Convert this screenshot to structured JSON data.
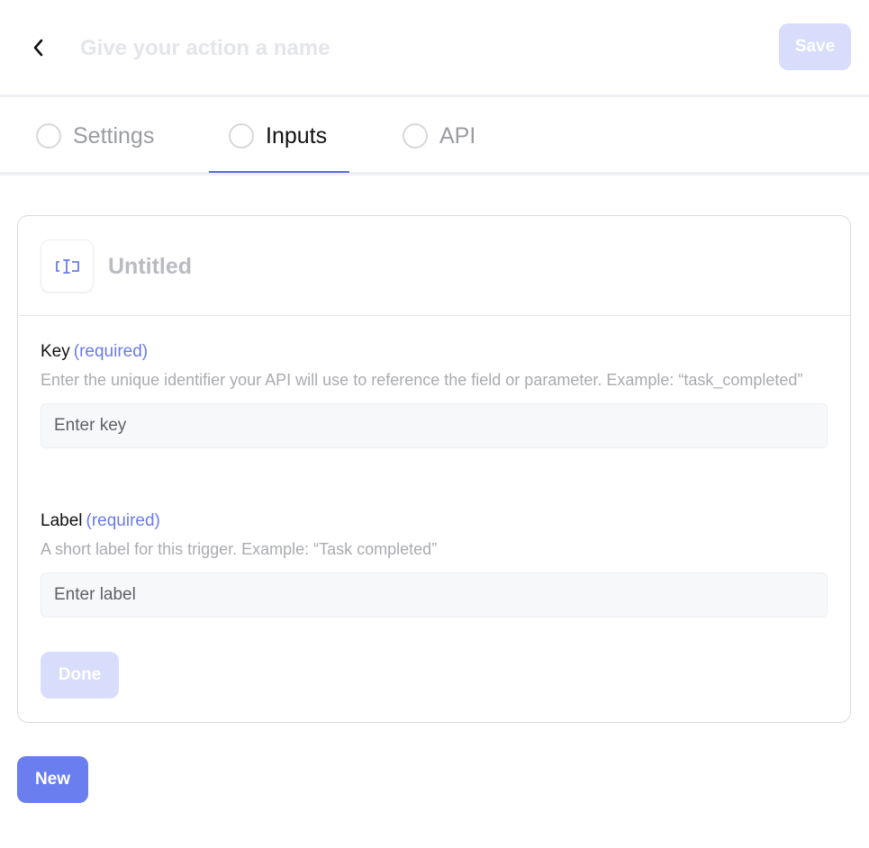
{
  "header": {
    "back_icon": "chevron-left-icon",
    "name_placeholder": "Give your action a name",
    "name_value": "",
    "save_label": "Save"
  },
  "tabs": [
    {
      "label": "Settings",
      "active": false,
      "icon": "radio-circle-icon"
    },
    {
      "label": "Inputs",
      "active": true,
      "icon": "radio-circle-icon"
    },
    {
      "label": "API",
      "active": false,
      "icon": "radio-circle-icon"
    }
  ],
  "input_card": {
    "icon": "text-field-cursor-icon",
    "title": "Untitled",
    "key": {
      "label": "Key",
      "required_text": "(required)",
      "help": "Enter the unique identifier your API will use to reference the field or parameter. Example: “task_completed”",
      "placeholder": "Enter key",
      "value": ""
    },
    "label_field": {
      "label": "Label",
      "required_text": "(required)",
      "help": "A short label for this trigger. Example: “Task completed”",
      "placeholder": "Enter label",
      "value": ""
    },
    "done_label": "Done"
  },
  "new_label": "New",
  "colors": {
    "accent": "#6b7ef0",
    "accent_disabled": "#d7ddfb",
    "required_text": "#6a7be6"
  }
}
